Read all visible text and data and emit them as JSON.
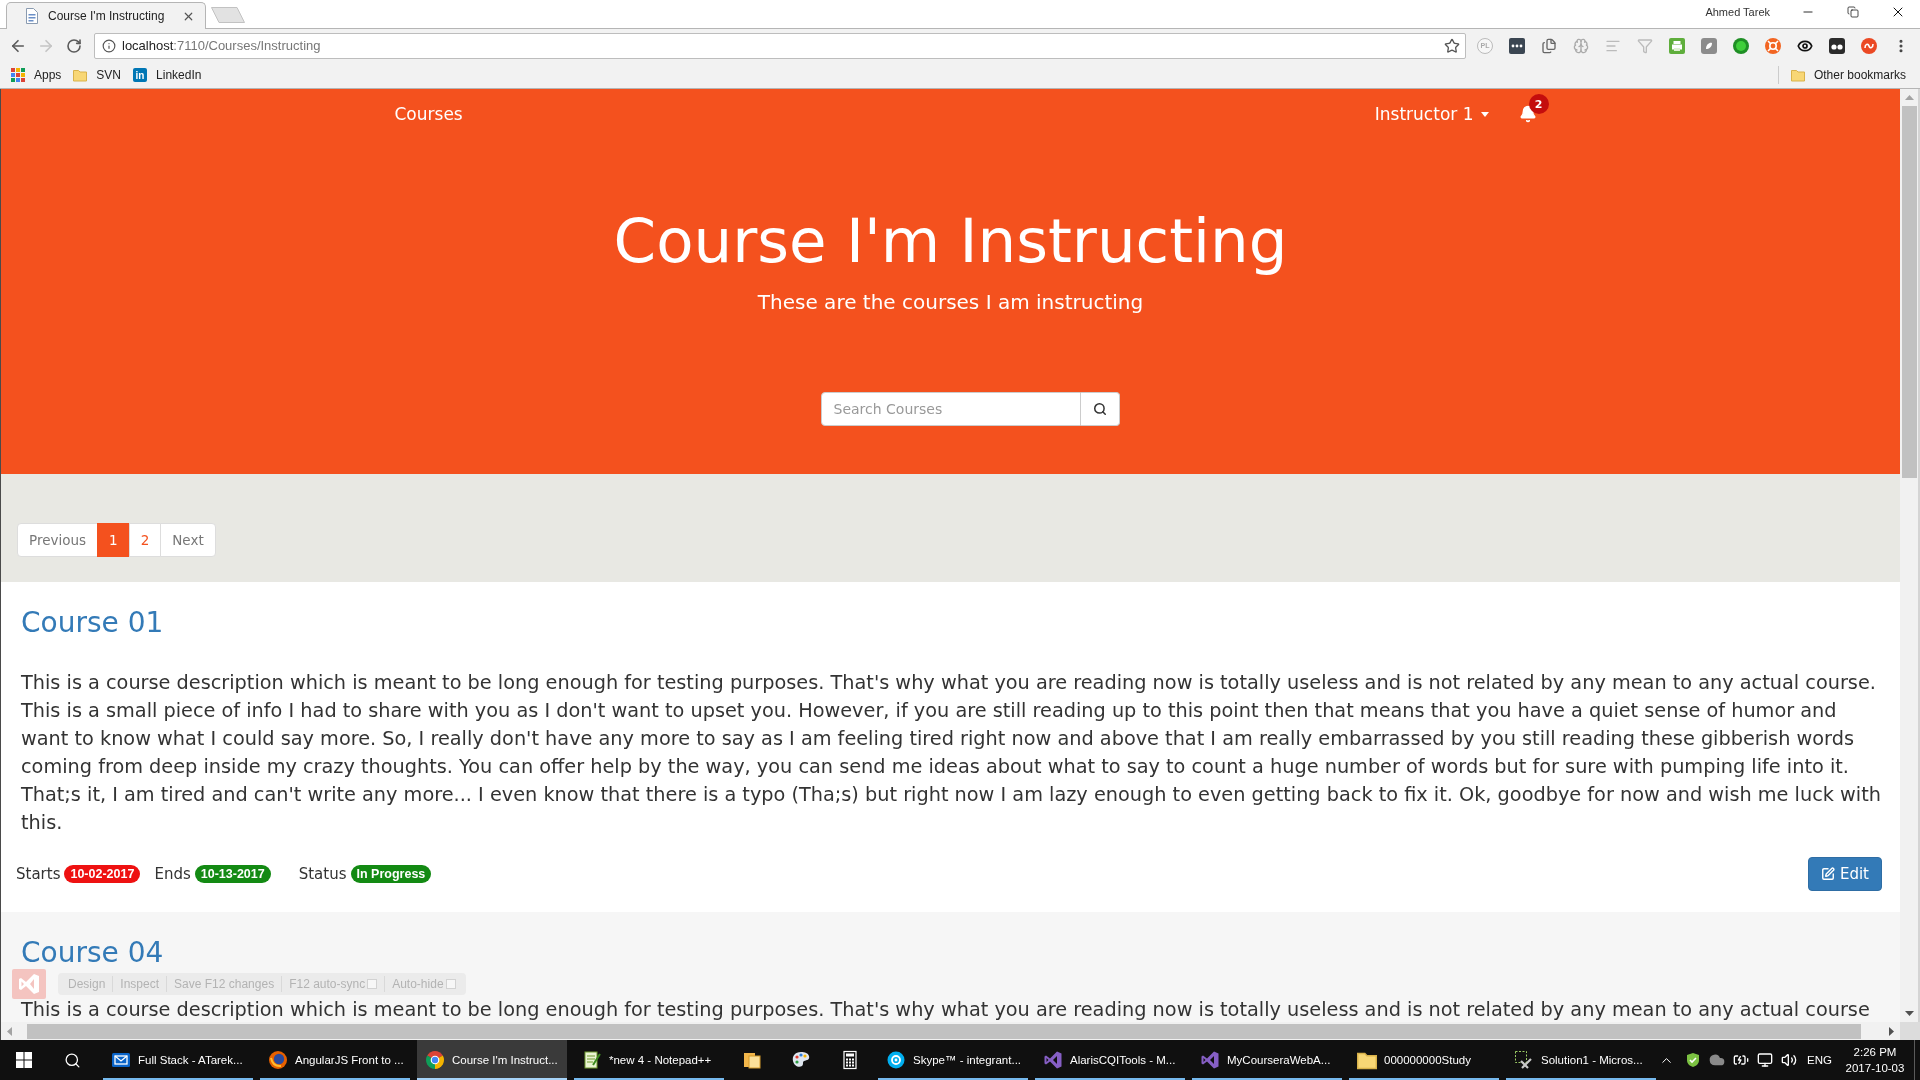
{
  "browser": {
    "tabs": [
      {
        "title": "Course I'm Instructing",
        "selected": true
      }
    ],
    "profile_name": "Ahmed Tarek",
    "nav_buttons": [
      {
        "kind": "back",
        "disabled": false
      },
      {
        "kind": "forward",
        "disabled": true
      },
      {
        "kind": "reload",
        "disabled": false
      }
    ],
    "address": {
      "host": "localhost",
      "path": ":7110/Courses/Instructing"
    },
    "extension_label": "PL",
    "bookmarks": [
      {
        "label": "Apps",
        "kind": "apps"
      },
      {
        "label": "SVN",
        "kind": "folder"
      },
      {
        "label": "LinkedIn",
        "kind": "logo",
        "logo_text": "in"
      }
    ],
    "other_bookmarks": "Other bookmarks"
  },
  "navbar": {
    "links": [
      {
        "label": "Courses"
      }
    ],
    "user_menu": "Instructor 1",
    "notification_count": "2"
  },
  "hero": {
    "title": "Course I'm Instructing",
    "subtitle": "These are the courses I am instructing",
    "search": {
      "placeholder": "Search Courses"
    }
  },
  "pagination": [
    {
      "label": "Previous",
      "kind": "step",
      "selected": false
    },
    {
      "label": "1",
      "kind": "page",
      "selected": true
    },
    {
      "label": "2",
      "kind": "page",
      "selected": false
    },
    {
      "label": "Next",
      "kind": "step",
      "selected": false
    }
  ],
  "courses": [
    {
      "title": "Course 01",
      "description": "This is a course description which is meant to be long enough for testing purposes. That's why what you are reading now is totally useless and is not related by any mean to any actual course. This is a small piece of info I had to share with you as I don't want to upset you. However, if you are still reading up to this point then that means that you have a quiet sense of humor and want to know what I could say more. So, I really don't have any more to say as I am feeling tired right now and above that I am really embarrassed by you still reading these gibberish words coming from deep inside my crazy thoughts. You can offer help by the way, you can send me ideas about what to say to count a huge number of words but for sure with pumping life into it. That;s it, I am tired and can't write any more... I even know that there is a typo (Tha;s) but right now I am lazy enough to even getting back to fix it. Ok, goodbye for now and wish me luck with this.",
      "dates": [
        {
          "label": "Starts",
          "value": "10-02-2017",
          "color": "#ee1111"
        },
        {
          "label": "Ends",
          "value": "10-13-2017",
          "color": "#138a13"
        }
      ],
      "status": {
        "label": "Status",
        "value": "In Progress",
        "color": "#138a13"
      },
      "edit_button": "Edit"
    },
    {
      "title": "Course 04",
      "description": "This is a course description which is meant to be long enough for testing purposes. That's why what you are reading now is totally useless and is not related by any mean to any actual course"
    }
  ],
  "browser_link_bar": {
    "items": [
      {
        "label": "Design",
        "kind": "action"
      },
      {
        "label": "Inspect",
        "kind": "action"
      },
      {
        "label": "Save F12 changes",
        "kind": "action"
      },
      {
        "label": "F12 auto-sync",
        "kind": "toggle",
        "checked": false
      },
      {
        "label": "Auto-hide",
        "kind": "toggle",
        "checked": false
      }
    ]
  },
  "taskbar": {
    "items": [
      {
        "label": "Full Stack - ATarek...",
        "kind": "mail",
        "running": true,
        "selected": false
      },
      {
        "label": "AngularJS Front to ...",
        "kind": "globe",
        "running": true,
        "selected": false
      },
      {
        "label": "Course I'm Instruct...",
        "kind": "browser",
        "running": true,
        "selected": true
      },
      {
        "label": "*new 4 - Notepad++",
        "kind": "notepad",
        "running": true,
        "selected": false
      },
      {
        "kind": "files",
        "running": false,
        "selected": false
      },
      {
        "kind": "palette",
        "running": false,
        "selected": false
      },
      {
        "kind": "calculator",
        "running": false,
        "selected": false
      },
      {
        "label": "Skype™ - integrant...",
        "kind": "chat",
        "running": true,
        "selected": false
      },
      {
        "label": "AlarisCQITools - M...",
        "kind": "ide",
        "running": true,
        "selected": false
      },
      {
        "label": "MyCourseraWebA...",
        "kind": "ide",
        "running": true,
        "selected": false
      },
      {
        "label": "000000000Study",
        "kind": "folder",
        "running": true,
        "selected": false
      },
      {
        "label": "Solution1 - Micros...",
        "kind": "tools",
        "running": true,
        "selected": false
      }
    ],
    "tray": {
      "language": "ENG",
      "time": "2:26 PM",
      "date": "2017-10-03"
    }
  }
}
